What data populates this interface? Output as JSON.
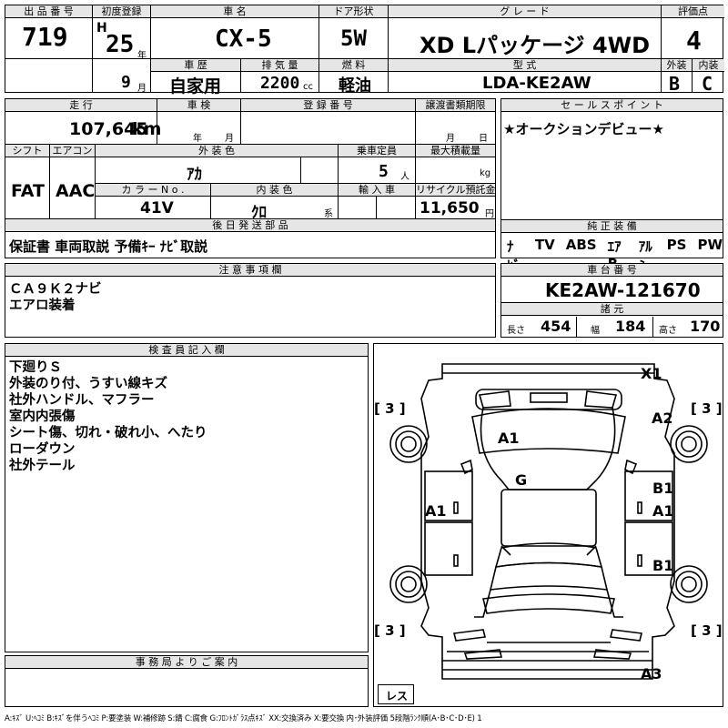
{
  "header": {
    "lot_no_label": "出 品 番 号",
    "lot_no": "719",
    "first_reg_label": "初度登録",
    "era": "H",
    "year": "25",
    "year_unit": "年",
    "month": "9",
    "month_unit": "月",
    "car_name_label": "車 名",
    "car_name": "CX-5",
    "door_label": "ドア形状",
    "door": "5W",
    "grade_label": "グ レ ー ド",
    "grade": "XD Lパッケージ 4WD",
    "score_label": "評価点",
    "score": "4",
    "history_label": "車 歴",
    "history": "自家用",
    "displacement_label": "排 気 量",
    "displacement": "2200",
    "displacement_unit": "cc",
    "fuel_label": "燃 料",
    "fuel": "軽油",
    "model_label": "型 式",
    "model": "LDA-KE2AW",
    "ext_label": "外装",
    "ext_grade": "B",
    "int_label": "内装",
    "int_grade": "C"
  },
  "block2": {
    "mileage_label": "走 行",
    "mileage": "107,645",
    "mileage_unit": "km",
    "inspection_label": "車 検",
    "inspection_year": "年",
    "inspection_month": "月",
    "reg_no_label": "登 録 番 号",
    "transfer_label": "譲渡書類期限",
    "transfer_month": "月",
    "transfer_day": "日",
    "shift_label": "シフト",
    "shift": "FAT",
    "ac_label": "エアコン",
    "ac": "AAC",
    "ext_color_label": "外 装 色",
    "ext_color": "ｱｶ",
    "capacity_label": "乗車定員",
    "capacity": "5",
    "capacity_unit": "人",
    "max_load_label": "最大積載量",
    "max_load_unit": "kg",
    "color_no_label": "カ ラ ー N o .",
    "color_no": "41V",
    "int_color_label": "内 装 色",
    "int_color": "ｸﾛ",
    "int_color_unit": "系",
    "import_label": "輸 入 車",
    "recycle_label": "リサイクル預託金",
    "recycle": "11,650",
    "recycle_unit": "円",
    "later_label": "後 日 発 送 部 品",
    "later": "保証書 車両取説 予備ｷｰ ﾅﾋﾞ取説"
  },
  "sales": {
    "label": "セ ー ル ス ポ イ ン ト",
    "text": "★オークションデビュー★"
  },
  "equipment": {
    "label": "純 正 装 備",
    "items": [
      "ﾅﾋﾞ",
      "TV",
      "ABS",
      "ｴｱB",
      "ｱﾙﾐ",
      "PS",
      "PW"
    ]
  },
  "caution": {
    "label": "注 意 事 項 欄",
    "lines": [
      "ＣＡ９Ｋ２ナビ",
      "エアロ装着"
    ]
  },
  "chassis": {
    "label": "車 台 番 号",
    "number": "KE2AW-121670",
    "spec_label": "諸 元",
    "length_label": "長さ",
    "length": "454",
    "width_label": "幅",
    "width": "184",
    "height_label": "高さ",
    "height": "170"
  },
  "inspector": {
    "label": "検 査 員 記 入 欄",
    "lines": [
      "下廻りＳ",
      "外装のり付、うすい線キズ",
      "社外ハンドル、マフラー",
      "室内内張傷",
      "シート傷、切れ・破れ小、へたり",
      "ローダウン",
      "社外テール"
    ]
  },
  "office": {
    "label": "事 務 局 よ り ご 案 内"
  },
  "diagram": {
    "marks": [
      "X1",
      "A2",
      "A1",
      "G",
      "A1",
      "B1",
      "A1",
      "B1",
      "A3"
    ],
    "tires": [
      "3",
      "3",
      "3",
      "3"
    ],
    "spare": "レス"
  },
  "legend": "A:ｷｽﾞ U:ﾍｺﾐ B:ｷｽﾞを伴うﾍｺﾐ P:要塗装 W:補修跡 S:錆 C:腐食 G:ﾌﾛﾝﾄｶﾞﾗｽ点ｷｽﾞ XX:交換済み X:要交換 内･外装評価 5段階ﾗﾝｸ順(A･B･C･D･E) 1"
}
